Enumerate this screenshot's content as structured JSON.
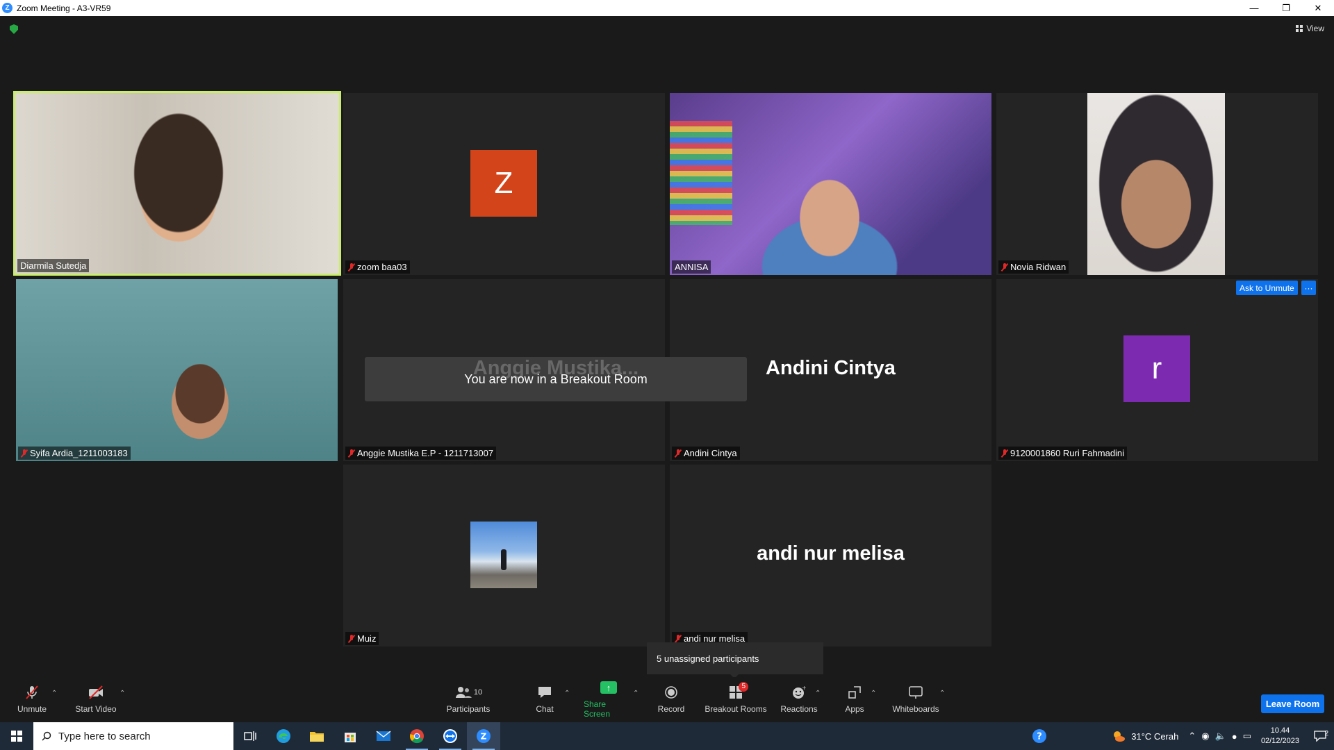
{
  "window": {
    "title": "Zoom Meeting - A3-VR59",
    "logo": "Z"
  },
  "top": {
    "view_label": "View"
  },
  "tiles": {
    "t1": {
      "name": "Diarmila Sutedja"
    },
    "t2": {
      "name": "zoom baa03",
      "avatar_letter": "Z",
      "avatar_color": "#d4441a"
    },
    "t3": {
      "name": "ANNISA"
    },
    "t4": {
      "name": "Novia Ridwan"
    },
    "t5": {
      "name": "Syifa Ardia_1211003183"
    },
    "t6": {
      "name": "Anggie Mustika E.P - 1211713007",
      "big": "Anggie Mustika..."
    },
    "t7": {
      "name": "Andini Cintya",
      "big": "Andini Cintya"
    },
    "t8": {
      "name": "9120001860 Ruri Fahmadini",
      "avatar_letter": "r",
      "avatar_color": "#7c2bb0",
      "ask_unmute": "Ask to Unmute",
      "more": "···"
    },
    "t9": {
      "name": "Muiz"
    },
    "t10": {
      "name": "andi nur melisa",
      "big": "andi nur melisa"
    }
  },
  "toast": {
    "message": "You are now in a Breakout Room"
  },
  "popup": {
    "unassigned": "5 unassigned participants"
  },
  "toolbar": {
    "unmute": "Unmute",
    "start_video": "Start Video",
    "participants": "Participants",
    "participants_count": "10",
    "chat": "Chat",
    "share_screen": "Share Screen",
    "record": "Record",
    "breakout_rooms": "Breakout Rooms",
    "breakout_badge": "5",
    "reactions": "Reactions",
    "apps": "Apps",
    "whiteboards": "Whiteboards",
    "leave": "Leave Room"
  },
  "taskbar": {
    "search_placeholder": "Type here to search",
    "weather": "31°C  Cerah",
    "time": "10.44",
    "date": "02/12/2023",
    "notif_count": "2"
  },
  "colors": {
    "accent": "#0e72ed",
    "active_speaker": "#c9ef6a",
    "share": "#24c063",
    "muted": "#e02828"
  }
}
